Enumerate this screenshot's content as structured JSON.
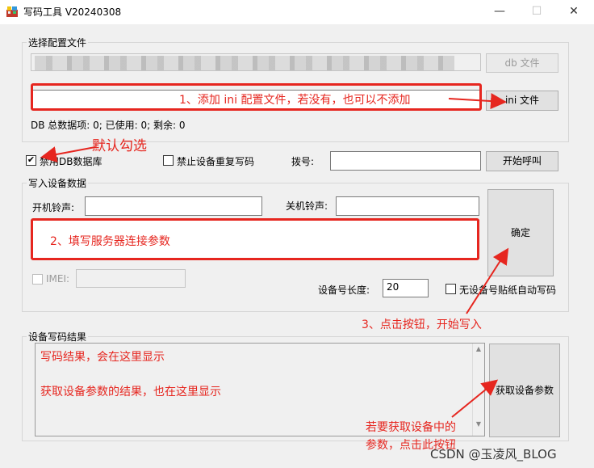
{
  "window": {
    "title": "写码工具 V20240308",
    "minimize": "—",
    "maximize": "☐",
    "close": "✕"
  },
  "config_group": {
    "title": "选择配置文件",
    "db_file_button": "db 文件",
    "ini_file_button": "ini 文件",
    "stats": "DB 总数据项: 0; 已使用: 0; 剩余: 0"
  },
  "options": {
    "disable_db_label": "禁用DB数据库",
    "disable_db_checked": true,
    "no_duplicate_label": "禁止设备重复写码",
    "no_duplicate_checked": false,
    "dial_label": "拨号:",
    "dial_value": "",
    "start_call_button": "开始呼叫"
  },
  "write_group": {
    "title": "写入设备数据",
    "power_on_label": "开机铃声:",
    "power_on_value": "",
    "power_off_label": "关机铃声:",
    "power_off_value": "",
    "confirm_button": "确定",
    "imei_label": "IMEI:",
    "imei_value": "",
    "imei_checked": false,
    "length_label": "设备号长度:",
    "length_value": "20",
    "no_sn_label": "无设备号贴纸自动写码",
    "no_sn_checked": false
  },
  "result_group": {
    "title": "设备写码结果",
    "line1": "写码结果，会在这里显示",
    "line2": "获取设备参数的结果，也在这里显示",
    "get_params_button": "获取设备参数"
  },
  "annotations": {
    "a1": "1、添加 ini 配置文件，若没有，也可以不添加",
    "a_default": "默认勾选",
    "a2": "2、填写服务器连接参数",
    "a3": "3、点击按钮，开始写入",
    "a4_line1": "若要获取设备中的",
    "a4_line2": "参数，点击此按钮",
    "color": "#e6261f"
  },
  "watermark": "CSDN @玉凌风_BLOG"
}
